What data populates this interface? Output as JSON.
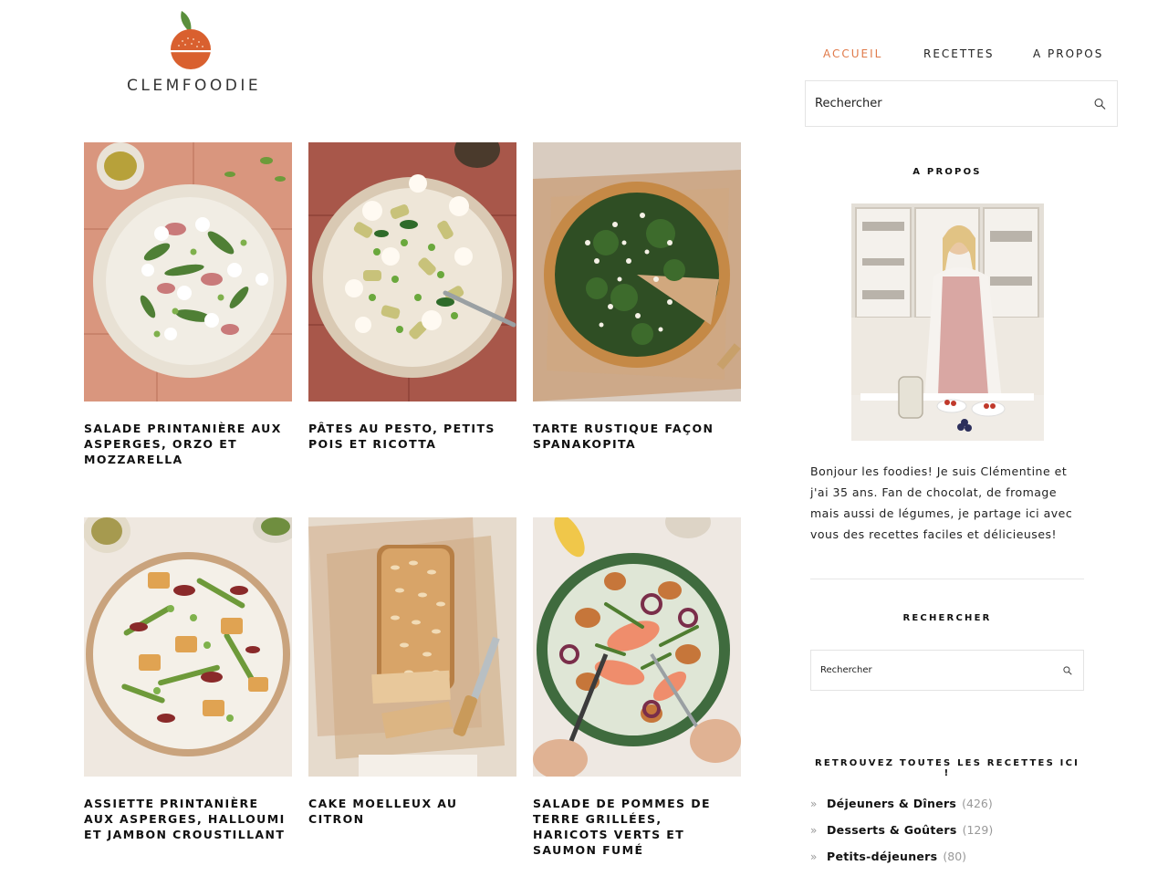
{
  "brand": {
    "name": "CLEMFOODIE",
    "colors": {
      "accent": "#e07a4a",
      "logo_orange": "#d9602f",
      "leaf": "#5a8f3c"
    }
  },
  "nav": {
    "items": [
      {
        "label": "ACCUEIL",
        "active": true
      },
      {
        "label": "RECETTES",
        "active": false
      },
      {
        "label": "A PROPOS",
        "active": false
      }
    ]
  },
  "search": {
    "placeholder": "Rechercher"
  },
  "recipes": [
    {
      "title": "SALADE PRINTANIÈRE AUX ASPERGES, ORZO ET MOZZARELLA"
    },
    {
      "title": "PÂTES AU PESTO, PETITS POIS ET RICOTTA"
    },
    {
      "title": "TARTE RUSTIQUE FAÇON SPANAKOPITA"
    },
    {
      "title": "ASSIETTE PRINTANIÈRE AUX ASPERGES, HALLOUMI ET JAMBON CROUSTILLANT"
    },
    {
      "title": "CAKE MOELLEUX AU CITRON"
    },
    {
      "title": "SALADE DE POMMES DE TERRE GRILLÉES, HARICOTS VERTS ET SAUMON FUMÉ"
    }
  ],
  "sidebar": {
    "about_heading": "A PROPOS",
    "bio": "Bonjour les foodies! Je suis Clémentine et j'ai 35 ans. Fan de chocolat, de fromage mais aussi de légumes, je partage ici avec vous des recettes faciles et délicieuses!",
    "search_heading": "RECHERCHER",
    "search_placeholder": "Rechercher",
    "categories_heading": "RETROUVEZ TOUTES LES RECETTES ICI !",
    "categories": [
      {
        "bullet": "»",
        "name": "Déjeuners & Dîners",
        "count": "(426)"
      },
      {
        "bullet": "»",
        "name": "Desserts & Goûters",
        "count": "(129)"
      },
      {
        "bullet": "»",
        "name": "Petits-déjeuners",
        "count": "(80)"
      }
    ]
  }
}
